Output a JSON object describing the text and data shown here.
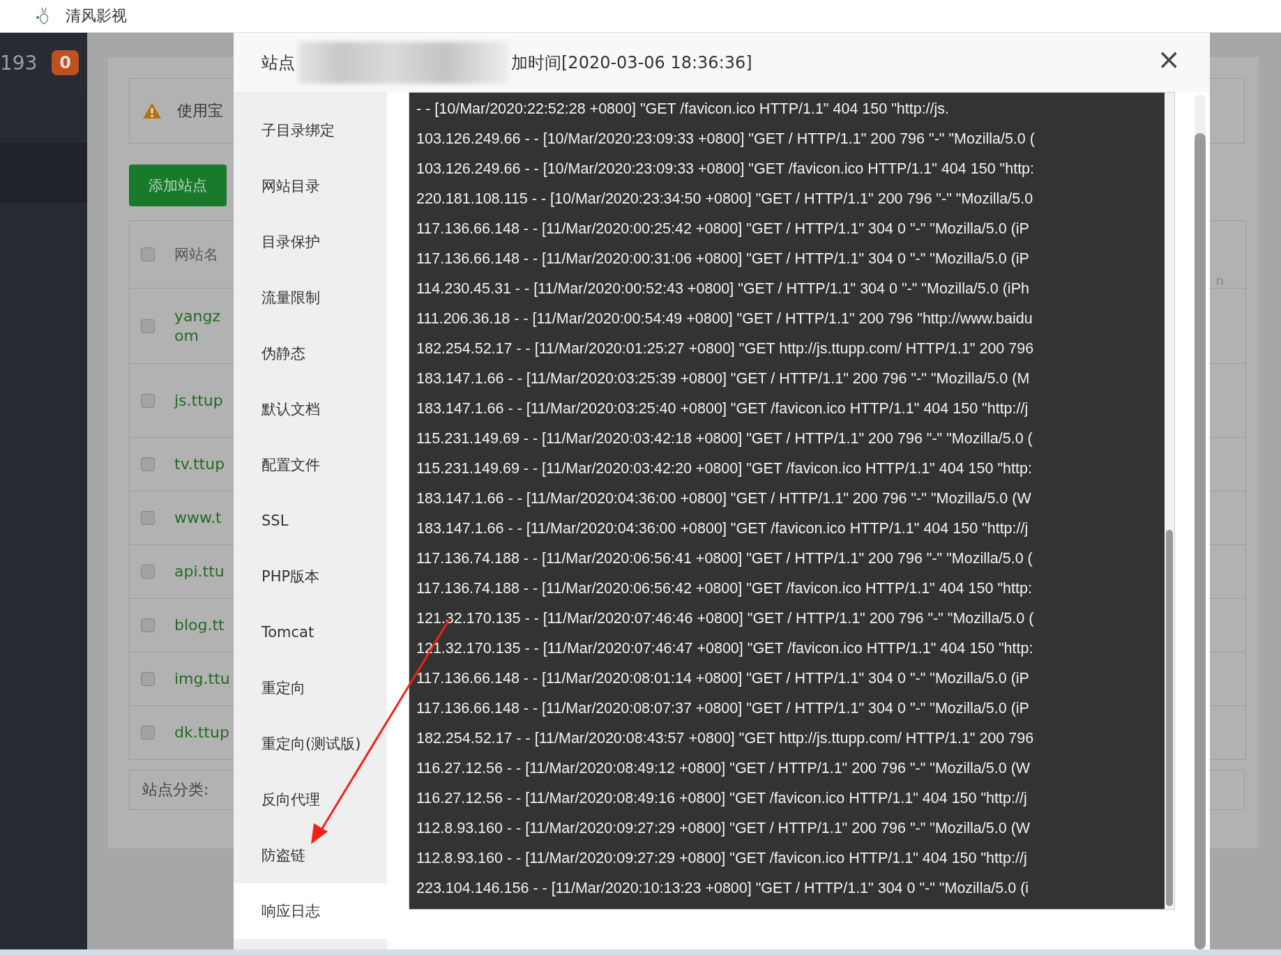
{
  "bookmark_bar": {
    "items": [
      {
        "label": "清风影视"
      }
    ]
  },
  "sidebar": {
    "count": "193",
    "badge": "0"
  },
  "page": {
    "alert": "使用宝",
    "add_button": "添加站点",
    "table": {
      "header": {
        "label": "网站名",
        "checked": false
      },
      "rows": [
        {
          "lines": [
            "yangz",
            "om"
          ],
          "checked": false
        },
        {
          "lines": [
            "js.ttup"
          ],
          "checked": false
        },
        {
          "lines": [
            "tv.ttup"
          ],
          "checked": false
        },
        {
          "lines": [
            "www.t"
          ],
          "checked": false
        },
        {
          "lines": [
            "api.ttu"
          ],
          "checked": false
        },
        {
          "lines": [
            "blog.tt"
          ],
          "checked": false
        },
        {
          "lines": [
            "img.ttu"
          ],
          "checked": false
        },
        {
          "lines": [
            "dk.ttup"
          ],
          "checked": false
        }
      ]
    },
    "footer_label": "站点分类:",
    "edge_text": "n"
  },
  "modal": {
    "title_start": "站点",
    "title_end": "加时间[2020-03-06 18:36:36]",
    "close": "×",
    "menu": [
      {
        "label": "子目录绑定",
        "selected": false
      },
      {
        "label": "网站目录",
        "selected": false
      },
      {
        "label": "目录保护",
        "selected": false
      },
      {
        "label": "流量限制",
        "selected": false
      },
      {
        "label": "伪静态",
        "selected": false
      },
      {
        "label": "默认文档",
        "selected": false
      },
      {
        "label": "配置文件",
        "selected": false
      },
      {
        "label": "SSL",
        "selected": false
      },
      {
        "label": "PHP版本",
        "selected": false
      },
      {
        "label": "Tomcat",
        "selected": false
      },
      {
        "label": "重定向",
        "selected": false
      },
      {
        "label": "重定向(测试版)",
        "selected": false
      },
      {
        "label": "反向代理",
        "selected": false
      },
      {
        "label": "防盗链",
        "selected": false
      },
      {
        "label": "响应日志",
        "selected": true
      }
    ],
    "log_lines": [
      "- - [10/Mar/2020:22:52:28 +0800] \"GET /favicon.ico HTTP/1.1\" 404 150 \"http://js.",
      "103.126.249.66 - - [10/Mar/2020:23:09:33 +0800] \"GET / HTTP/1.1\" 200 796 \"-\" \"Mozilla/5.0 (",
      "103.126.249.66 - - [10/Mar/2020:23:09:33 +0800] \"GET /favicon.ico HTTP/1.1\" 404 150 \"http:",
      "220.181.108.115 - - [10/Mar/2020:23:34:50 +0800] \"GET / HTTP/1.1\" 200 796 \"-\" \"Mozilla/5.0",
      "117.136.66.148 - - [11/Mar/2020:00:25:42 +0800] \"GET / HTTP/1.1\" 304 0 \"-\" \"Mozilla/5.0 (iP",
      "117.136.66.148 - - [11/Mar/2020:00:31:06 +0800] \"GET / HTTP/1.1\" 304 0 \"-\" \"Mozilla/5.0 (iP",
      "114.230.45.31 - - [11/Mar/2020:00:52:43 +0800] \"GET / HTTP/1.1\" 304 0 \"-\" \"Mozilla/5.0 (iPh",
      "111.206.36.18 - - [11/Mar/2020:00:54:49 +0800] \"GET / HTTP/1.1\" 200 796 \"http://www.baidu",
      "182.254.52.17 - - [11/Mar/2020:01:25:27 +0800] \"GET http://js.ttupp.com/ HTTP/1.1\" 200 796",
      "183.147.1.66 - - [11/Mar/2020:03:25:39 +0800] \"GET / HTTP/1.1\" 200 796 \"-\" \"Mozilla/5.0 (M",
      "183.147.1.66 - - [11/Mar/2020:03:25:40 +0800] \"GET /favicon.ico HTTP/1.1\" 404 150 \"http://j",
      "115.231.149.69 - - [11/Mar/2020:03:42:18 +0800] \"GET / HTTP/1.1\" 200 796 \"-\" \"Mozilla/5.0 (",
      "115.231.149.69 - - [11/Mar/2020:03:42:20 +0800] \"GET /favicon.ico HTTP/1.1\" 404 150 \"http:",
      "183.147.1.66 - - [11/Mar/2020:04:36:00 +0800] \"GET / HTTP/1.1\" 200 796 \"-\" \"Mozilla/5.0 (W",
      "183.147.1.66 - - [11/Mar/2020:04:36:00 +0800] \"GET /favicon.ico HTTP/1.1\" 404 150 \"http://j",
      "117.136.74.188 - - [11/Mar/2020:06:56:41 +0800] \"GET / HTTP/1.1\" 200 796 \"-\" \"Mozilla/5.0 (",
      "117.136.74.188 - - [11/Mar/2020:06:56:42 +0800] \"GET /favicon.ico HTTP/1.1\" 404 150 \"http:",
      "121.32.170.135 - - [11/Mar/2020:07:46:46 +0800] \"GET / HTTP/1.1\" 200 796 \"-\" \"Mozilla/5.0 (",
      "121.32.170.135 - - [11/Mar/2020:07:46:47 +0800] \"GET /favicon.ico HTTP/1.1\" 404 150 \"http:",
      "117.136.66.148 - - [11/Mar/2020:08:01:14 +0800] \"GET / HTTP/1.1\" 304 0 \"-\" \"Mozilla/5.0 (iP",
      "117.136.66.148 - - [11/Mar/2020:08:07:37 +0800] \"GET / HTTP/1.1\" 304 0 \"-\" \"Mozilla/5.0 (iP",
      "182.254.52.17 - - [11/Mar/2020:08:43:57 +0800] \"GET http://js.ttupp.com/ HTTP/1.1\" 200 796",
      "116.27.12.56 - - [11/Mar/2020:08:49:12 +0800] \"GET / HTTP/1.1\" 200 796 \"-\" \"Mozilla/5.0 (W",
      "116.27.12.56 - - [11/Mar/2020:08:49:16 +0800] \"GET /favicon.ico HTTP/1.1\" 404 150 \"http://j",
      "112.8.93.160 - - [11/Mar/2020:09:27:29 +0800] \"GET / HTTP/1.1\" 200 796 \"-\" \"Mozilla/5.0 (W",
      "112.8.93.160 - - [11/Mar/2020:09:27:29 +0800] \"GET /favicon.ico HTTP/1.1\" 404 150 \"http://j",
      "223.104.146.156 - - [11/Mar/2020:10:13:23 +0800] \"GET / HTTP/1.1\" 304 0 \"-\" \"Mozilla/5.0 (i"
    ]
  }
}
